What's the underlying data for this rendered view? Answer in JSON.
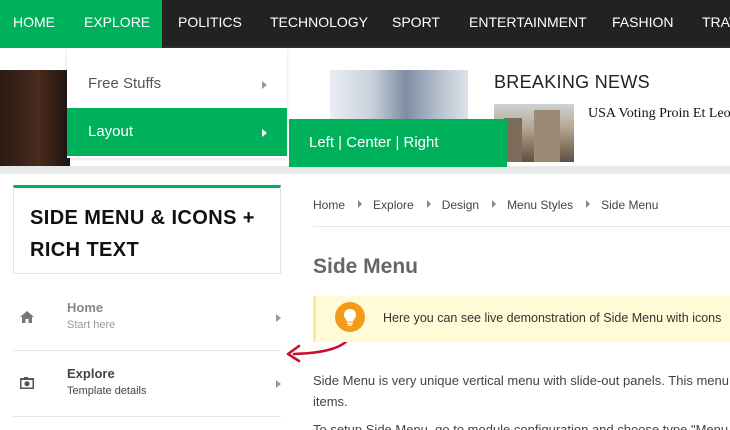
{
  "nav": {
    "items": [
      {
        "label": "HOME"
      },
      {
        "label": "EXPLORE",
        "active": true
      },
      {
        "label": "POLITICS"
      },
      {
        "label": "TECHNOLOGY"
      },
      {
        "label": "SPORT"
      },
      {
        "label": "ENTERTAINMENT"
      },
      {
        "label": "FASHION"
      },
      {
        "label": "TRAV"
      }
    ]
  },
  "dropdown": {
    "items": [
      {
        "label": "Free Stuffs"
      },
      {
        "label": "Layout",
        "active": true
      }
    ],
    "submenu_label": "Left | Center | Right"
  },
  "breaking": {
    "title": "BREAKING NEWS",
    "headline": "USA Voting Proin Et Leo Ut Enim Fringilla Inter"
  },
  "sidebar": {
    "title": "SIDE MENU & ICONS + RICH TEXT",
    "items": [
      {
        "label": "Home",
        "sub": "Start here",
        "icon": "home-icon"
      },
      {
        "label": "Explore",
        "sub": "Template details",
        "icon": "camera-icon"
      }
    ]
  },
  "breadcrumb": [
    "Home",
    "Explore",
    "Design",
    "Menu Styles",
    "Side Menu"
  ],
  "main": {
    "title": "Side Menu",
    "notice": "Here you can see live demonstration of Side Menu with icons",
    "body_line1": "Side Menu is very unique vertical menu with slide-out panels. This menu",
    "body_line2": "items.",
    "body_line3": "To setup Side Menu, go to module configuration and choose type \"Menu"
  },
  "colors": {
    "accent": "#00b15c",
    "nav_bg": "#222222",
    "notice_bg": "#fffbd6",
    "bulb": "#f39c1c",
    "annotation": "#c8102e"
  }
}
